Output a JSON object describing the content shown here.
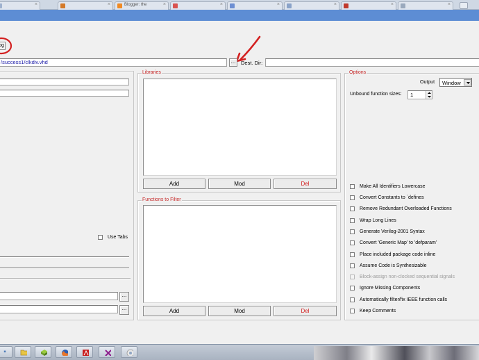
{
  "browser": {
    "tabs": [
      {
        "label": "",
        "color": "#9fb2cf"
      },
      {
        "label": "",
        "color": "#d47a2a"
      },
      {
        "label": "Blogger: the",
        "color": "#f08a24"
      },
      {
        "label": "",
        "color": "#d9534f"
      },
      {
        "label": "",
        "color": "#6d8fd3"
      },
      {
        "label": "",
        "color": "#8aa3c9"
      },
      {
        "label": "",
        "color": "#c0392b"
      },
      {
        "label": "",
        "color": "#9aa9bd"
      }
    ],
    "accent_color": "#5d8dd4"
  },
  "toolbar": {
    "circled_button_label": "og",
    "circle_color": "#d32020",
    "arrow_color": "#d32020"
  },
  "file": {
    "source_path": "/success1/clkdiv.vhd",
    "browse_label": "...",
    "dest_label": "Dest. Dir:",
    "dest_value": ""
  },
  "left_panel": {
    "use_tabs_label": "Use Tabs",
    "browse_label_1": "...",
    "browse_label_2": "..."
  },
  "libraries": {
    "title": "Libraries",
    "add_label": "Add",
    "mod_label": "Mod",
    "del_label": "Del"
  },
  "functions": {
    "title": "Functions to Filter",
    "add_label": "Add",
    "mod_label": "Mod",
    "del_label": "Del"
  },
  "options": {
    "title": "Options",
    "output_label": "Output",
    "output_value": "Window",
    "unbound_label": "Unbound function sizes:",
    "unbound_value": "1",
    "checkboxes": [
      {
        "label": "Make All Identifiers Lowercase",
        "enabled": true
      },
      {
        "label": "Convert Constants to `defines",
        "enabled": true
      },
      {
        "label": "Remove Redundant Overloaded Functions",
        "enabled": true
      },
      {
        "label": "Wrap Long Lines",
        "enabled": true
      },
      {
        "label": "Generate Verilog-2001 Syntax",
        "enabled": true
      },
      {
        "label": "Convert 'Generic Map' to 'defparam'",
        "enabled": true
      },
      {
        "label": "Place included package code inline",
        "enabled": true
      },
      {
        "label": "Assume Code is Synthesizable",
        "enabled": true
      },
      {
        "label": "Block-assign non-clocked sequential signals",
        "enabled": false
      },
      {
        "label": "Ignore Missing Components",
        "enabled": true
      },
      {
        "label": "Automatically filter/fix IEEE function calls",
        "enabled": true
      },
      {
        "label": "Keep Comments",
        "enabled": true
      }
    ]
  },
  "taskbar": {
    "icons": [
      "app-icon",
      "folder-icon",
      "cube-icon",
      "firefox-icon",
      "pdf-icon",
      "xilinx-icon",
      "chrome-icon"
    ]
  }
}
